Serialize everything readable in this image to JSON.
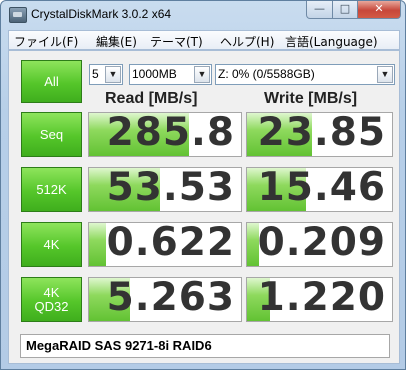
{
  "window": {
    "title": "CrystalDiskMark 3.0.2 x64",
    "min_glyph": "—",
    "max_glyph": "□",
    "close_glyph": "✕"
  },
  "menu": [
    "ファイル(F)",
    "編集(E)",
    "テーマ(T)",
    "ヘルプ(H)",
    "言語(Language)"
  ],
  "controls": {
    "all_label": "All",
    "runs": "5",
    "size": "1000MB",
    "drive": "Z: 0% (0/5588GB)"
  },
  "headers": {
    "read": "Read [MB/s]",
    "write": "Write [MB/s]"
  },
  "tests": [
    {
      "label_1": "Seq",
      "label_2": "",
      "read": "285.8",
      "write": "23.85",
      "read_fill": 0.66,
      "write_fill": 0.45
    },
    {
      "label_1": "512K",
      "label_2": "",
      "read": "53.53",
      "write": "15.46",
      "read_fill": 0.47,
      "write_fill": 0.41
    },
    {
      "label_1": "4K",
      "label_2": "",
      "read": "0.622",
      "write": "0.209",
      "read_fill": 0.11,
      "write_fill": 0.08
    },
    {
      "label_1": "4K",
      "label_2": "QD32",
      "read": "5.263",
      "write": "1.220",
      "read_fill": 0.27,
      "write_fill": 0.16
    }
  ],
  "comment": "MegaRAID SAS 9271-8i RAID6",
  "colors": {
    "accent_green": "#55c62a",
    "bar_green": "#8ed95d"
  }
}
